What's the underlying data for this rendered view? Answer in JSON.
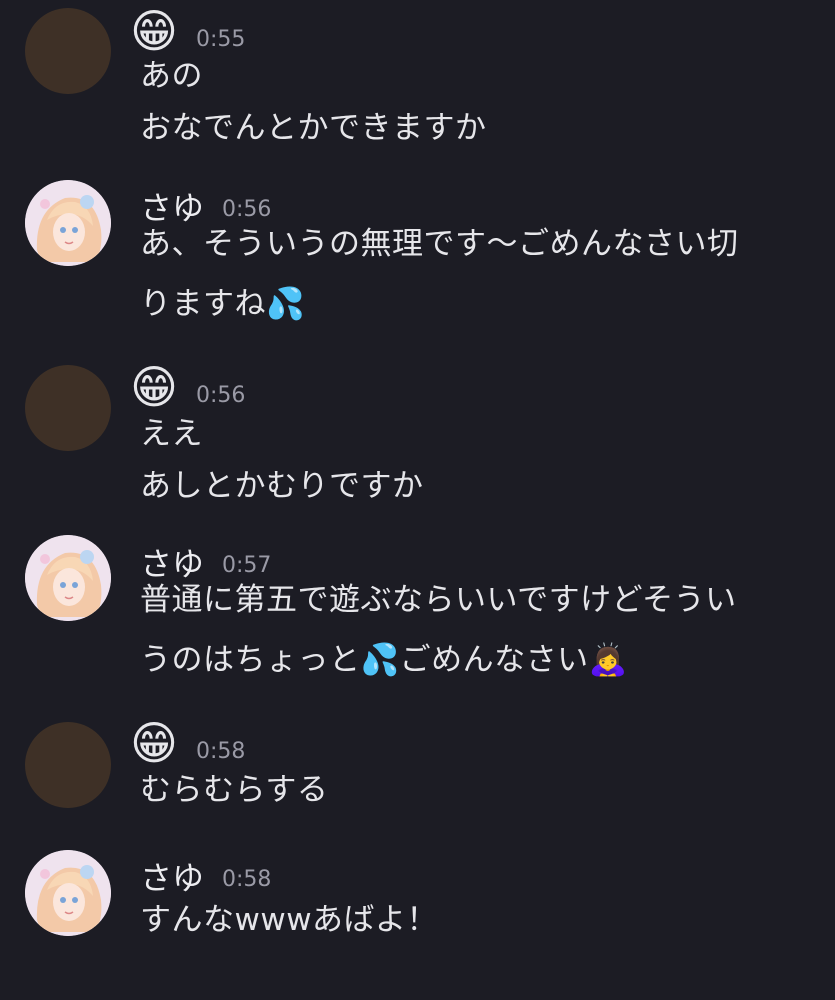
{
  "messages": [
    {
      "sender": "",
      "sender_emoji": "😁",
      "time": "0:55",
      "lines": [
        "あの",
        "おなでんとかできますか"
      ]
    },
    {
      "sender": "さゆ",
      "time": "0:56",
      "lines": [
        "あ、そういうの無理です〜ごめんなさい切",
        "りますね💦"
      ]
    },
    {
      "sender": "",
      "sender_emoji": "😁",
      "time": "0:56",
      "lines": [
        "ええ",
        "あしとかむりですか"
      ]
    },
    {
      "sender": "さゆ",
      "time": "0:57",
      "lines": [
        "普通に第五で遊ぶならいいですけどそうい",
        "うのはちょっと💦ごめんなさい🙇‍♀️"
      ]
    },
    {
      "sender": "",
      "sender_emoji": "😁",
      "time": "0:58",
      "lines": [
        "むらむらする"
      ]
    },
    {
      "sender": "さゆ",
      "time": "0:58",
      "lines": [
        "すんなwwwあばよ！"
      ]
    }
  ]
}
